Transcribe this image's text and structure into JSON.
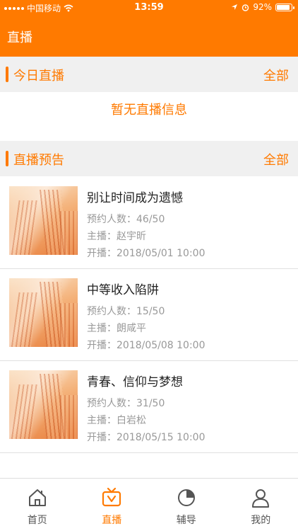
{
  "status": {
    "carrier": "中国移动",
    "time": "13:59",
    "battery": "92%",
    "battery_level": 0.92
  },
  "nav": {
    "title": "直播"
  },
  "today": {
    "title": "今日直播",
    "more": "全部",
    "empty": "暂无直播信息"
  },
  "upcoming": {
    "title": "直播预告",
    "more": "全部",
    "items": [
      {
        "name": "别让时间成为遗憾",
        "booking": "预约人数：46/50",
        "host": "主播：赵宇昕",
        "start": "开播：2018/05/01 10:00"
      },
      {
        "name": "中等收入陷阱",
        "booking": "预约人数：15/50",
        "host": "主播：朗咸平",
        "start": "开播：2018/05/08 10:00"
      },
      {
        "name": "青春、信仰与梦想",
        "booking": "预约人数：31/50",
        "host": "主播：白岩松",
        "start": "开播：2018/05/15 10:00"
      }
    ]
  },
  "tabs": [
    {
      "label": "首页",
      "icon": "home-icon"
    },
    {
      "label": "直播",
      "icon": "tv-icon",
      "active": true
    },
    {
      "label": "辅导",
      "icon": "pie-chart-icon"
    },
    {
      "label": "我的",
      "icon": "user-icon"
    }
  ],
  "colors": {
    "accent": "#ff7a00",
    "section_bg": "#f0f0f0"
  }
}
